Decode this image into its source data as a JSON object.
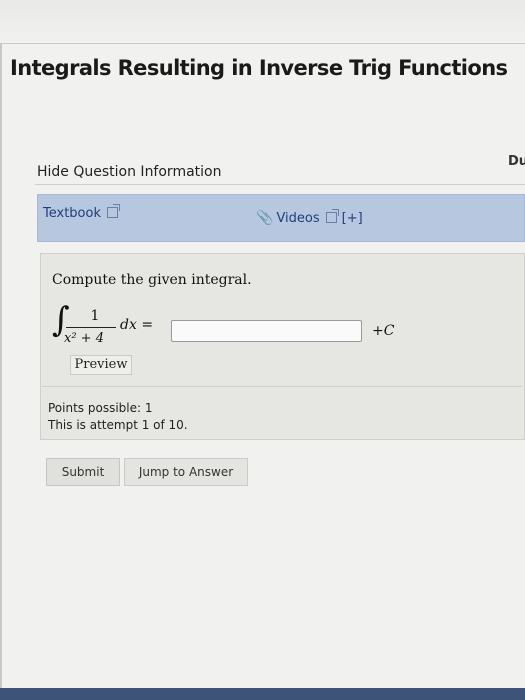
{
  "page": {
    "title": "Integrals Resulting in Inverse Trig Functions",
    "due_label": "Du"
  },
  "question_info": {
    "hide_label": "Hide Question Information"
  },
  "resources": {
    "textbook_label": "Textbook",
    "videos_label": "Videos",
    "expand_label": "[+]"
  },
  "question": {
    "prompt": "Compute the given integral.",
    "integral_sign": "∫",
    "numerator": "1",
    "denominator": "x² + 4",
    "dx": "dx",
    "equals": "=",
    "answer_value": "",
    "plus": "+",
    "constant": "C",
    "preview_label": "Preview"
  },
  "status": {
    "points": "Points possible: 1",
    "attempt": "This is attempt 1 of 10."
  },
  "actions": {
    "submit_label": "Submit",
    "jump_label": "Jump to Answer"
  },
  "icons": {
    "external_link": "external-link-icon",
    "paperclip": "paperclip-icon"
  }
}
